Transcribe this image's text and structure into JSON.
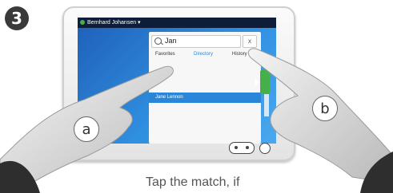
{
  "step_number": "3",
  "device": {
    "user_name": "Bernhard Johansen ▾",
    "search": {
      "query": "Jan",
      "clear_glyph": "x"
    },
    "tabs": [
      {
        "label": "Favorites",
        "active": false
      },
      {
        "label": "Directory",
        "active": true
      },
      {
        "label": "History",
        "active": false
      }
    ],
    "result_name": "Jane Lennon",
    "accent_color": "#2a86d8",
    "call_color": "#45b04a"
  },
  "callouts": {
    "a": "a",
    "b": "b"
  },
  "caption": "Tap the match, if"
}
